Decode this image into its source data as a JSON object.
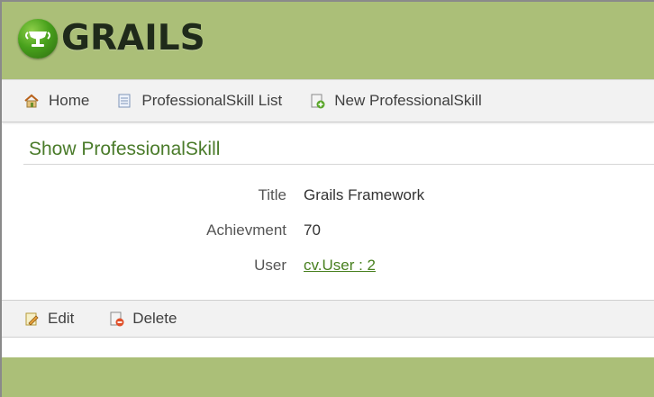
{
  "header": {
    "logo_text": "GRAILS"
  },
  "nav": {
    "home": "Home",
    "list": "ProfessionalSkill List",
    "create": "New ProfessionalSkill"
  },
  "page": {
    "title": "Show ProfessionalSkill"
  },
  "fields": [
    {
      "label": "Title",
      "value": "Grails Framework"
    },
    {
      "label": "Achievment",
      "value": "70"
    },
    {
      "label": "User",
      "value": "cv.User : 2"
    }
  ],
  "buttons": {
    "edit": "Edit",
    "delete": "Delete"
  },
  "colors": {
    "header_bg": "#abbf78",
    "link": "#48801f",
    "title": "#4a7b2a"
  }
}
